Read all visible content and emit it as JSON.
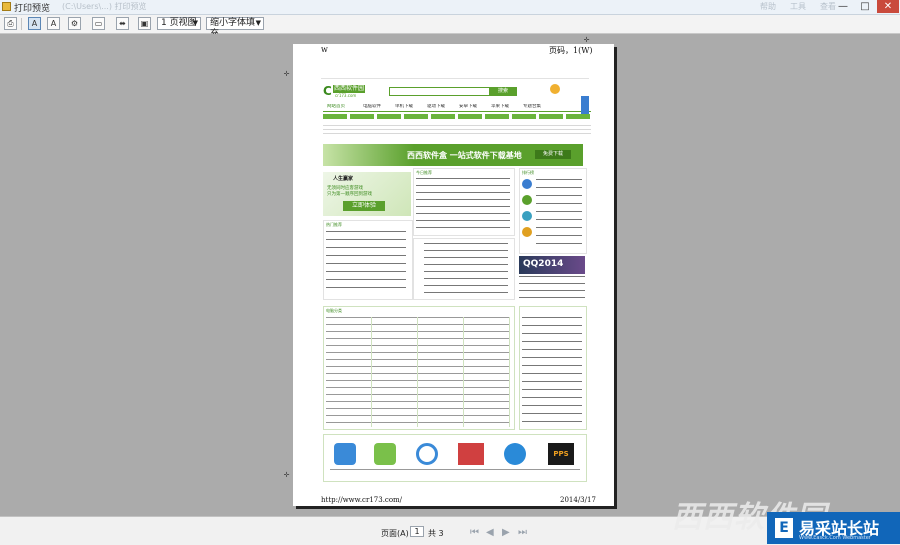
{
  "window": {
    "title": "打印预览",
    "faint_subtitle": "(C:\\Users\\...) 打印预览",
    "faint_menu": [
      "帮助",
      "工具",
      "查看"
    ],
    "controls": {
      "minimize": "—",
      "maximize": "□",
      "close": "✕"
    }
  },
  "toolbar": {
    "view_mode_value": "1 页视图",
    "scale_value": "缩小字体填充",
    "icons": [
      "print-icon",
      "portrait-icon",
      "landscape-icon",
      "settings-icon",
      "header-footer-icon",
      "full-width-icon",
      "full-page-icon"
    ]
  },
  "page": {
    "header_left": "w",
    "header_right": "页码，1(W)",
    "footer_left": "http://www.cr173.com/",
    "footer_right": "2014/3/17",
    "site": {
      "logo_text": "西西软件园",
      "logo_url": "cr173.com",
      "search_value": "搜索",
      "nav_items": [
        "网站首页",
        "电脑软件",
        "单机下载",
        "驱动下载",
        "安卓下载",
        "苹果下载",
        "专题合集"
      ],
      "banner_text": "西西软件盒  一站式软件下载基地",
      "banner_button": "免费下载",
      "ad_title": "人生赢家",
      "ad_line1": "无须同时应客游戏",
      "ad_line2": "只为第一顺序回到游戏",
      "ad_button": "立即体验",
      "section_today": "今日推荐",
      "section_hot": "热门推荐",
      "section_category": "电脑分类",
      "section_ranking": "排行榜",
      "section_recommend": "推荐软件",
      "qq_banner": "QQ2014",
      "bottom_icons": [
        "应用助手",
        "爱奇艺",
        "找我",
        "植物大战",
        "搜狗浏览器",
        "PPS"
      ]
    }
  },
  "statusbar": {
    "page_label": "页面(A)",
    "page_value": "1",
    "total_label": "共 3"
  },
  "watermark": {
    "text": "西西软件园",
    "brand": "易采站长站",
    "brand_sub": "Www.Easck.Com Webmaster"
  },
  "colors": {
    "accent_green": "#3b8a1e",
    "banner_green": "#5aa02c",
    "link_red": "#d4301c",
    "watermark_blue": "#1166b9"
  }
}
